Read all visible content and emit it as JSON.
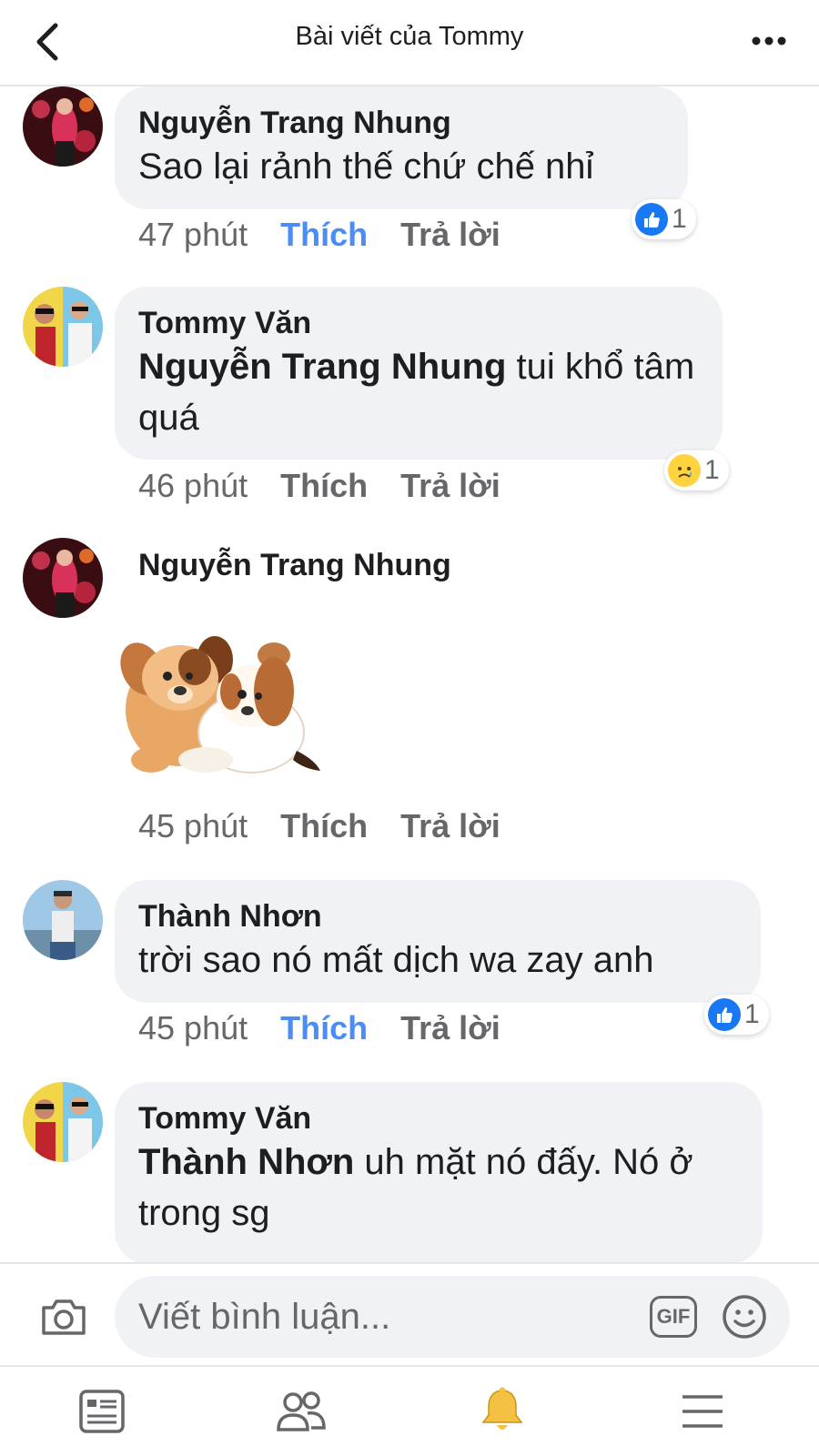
{
  "header": {
    "title": "Bài viết của Tommy"
  },
  "comments": [
    {
      "author": "Nguyễn Trang Nhung",
      "text": "Sao lại rảnh thế chứ chế nhỉ",
      "mention": "",
      "time": "47 phút",
      "like_label": "Thích",
      "reply_label": "Trả lời",
      "liked": true,
      "reaction": {
        "icon": "like-reaction-icon",
        "count": "1"
      }
    },
    {
      "author": "Tommy Văn",
      "mention": "Nguyễn Trang Nhung",
      "text": " tui khổ tâm quá",
      "time": "46 phút",
      "like_label": "Thích",
      "reply_label": "Trả lời",
      "liked": false,
      "reaction": {
        "icon": "sad-reaction-icon",
        "count": "1"
      }
    },
    {
      "author": "Nguyễn Trang Nhung",
      "sticker": "dogs-hugging-sticker",
      "time": "45 phút",
      "like_label": "Thích",
      "reply_label": "Trả lời",
      "liked": false
    },
    {
      "author": "Thành Nhơn",
      "mention": "",
      "text": "trời sao nó mất dịch wa zay anh",
      "time": "45 phút",
      "like_label": "Thích",
      "reply_label": "Trả lời",
      "liked": true,
      "reaction": {
        "icon": "like-reaction-icon",
        "count": "1"
      }
    },
    {
      "author": "Tommy Văn",
      "mention": "Thành Nhơn",
      "text": " uh mặt nó đấy. Nó ở trong sg"
    }
  ],
  "composer": {
    "placeholder": "Viết bình luận...",
    "gif_label": "GIF"
  },
  "colors": {
    "accent_blue": "#4a8df8",
    "bubble_bg": "#f0f2f5",
    "meta_gray": "#65676b",
    "bell_yellow": "#f5c142"
  },
  "tabs": [
    {
      "icon": "news-feed-icon"
    },
    {
      "icon": "friends-icon"
    },
    {
      "icon": "notifications-bell-icon",
      "active": true
    },
    {
      "icon": "menu-icon"
    }
  ]
}
